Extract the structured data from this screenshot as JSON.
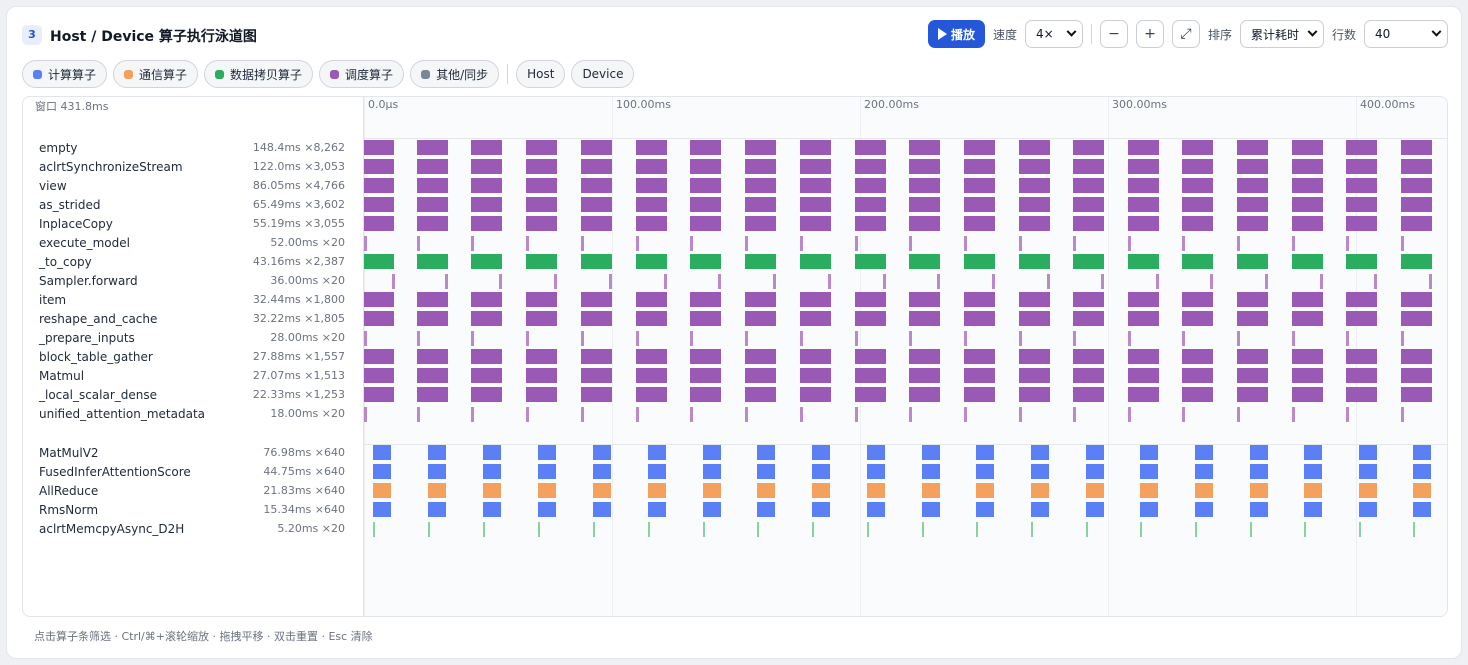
{
  "header": {
    "step": "3",
    "title": "Host / Device 算子执行泳道图",
    "play_label": "播放",
    "speed_label": "速度",
    "speed_value": "4×",
    "zoom_out": "−",
    "zoom_in": "+",
    "fit": "⤢",
    "sort_label": "排序",
    "sort_value": "累计耗时",
    "rows_label": "行数",
    "rows_value": "40"
  },
  "colors": {
    "compute": "#5b7ff5",
    "comm": "#f4a15d",
    "copy": "#2aad5e",
    "sched": "#9b59b6",
    "other": "#7b8794"
  },
  "filters": {
    "compute": "计算算子",
    "comm": "通信算子",
    "copy": "数据拷贝算子",
    "sched": "调度算子",
    "other": "其他/同步",
    "host": "Host",
    "device": "Device"
  },
  "axis": {
    "window_label": "窗口 431.8ms",
    "ticks": [
      "0.0μs",
      "100.00ms",
      "200.00ms",
      "300.00ms",
      "400.00ms"
    ]
  },
  "host_rows": [
    {
      "name": "empty",
      "stat": "148.4ms ×8,262",
      "kind": "sched"
    },
    {
      "name": "aclrtSynchronizeStream",
      "stat": "122.0ms ×3,053",
      "kind": "sched"
    },
    {
      "name": "view",
      "stat": "86.05ms ×4,766",
      "kind": "sched"
    },
    {
      "name": "as_strided",
      "stat": "65.49ms ×3,602",
      "kind": "sched"
    },
    {
      "name": "InplaceCopy",
      "stat": "55.19ms ×3,055",
      "kind": "sched"
    },
    {
      "name": "execute_model",
      "stat": "52.00ms ×20",
      "kind": "sched"
    },
    {
      "name": "_to_copy",
      "stat": "43.16ms ×2,387",
      "kind": "copy"
    },
    {
      "name": "Sampler.forward",
      "stat": "36.00ms ×20",
      "kind": "sched"
    },
    {
      "name": "item",
      "stat": "32.44ms ×1,800",
      "kind": "sched"
    },
    {
      "name": "reshape_and_cache",
      "stat": "32.22ms ×1,805",
      "kind": "sched"
    },
    {
      "name": "_prepare_inputs",
      "stat": "28.00ms ×20",
      "kind": "sched"
    },
    {
      "name": "block_table_gather",
      "stat": "27.88ms ×1,557",
      "kind": "sched"
    },
    {
      "name": "Matmul",
      "stat": "27.07ms ×1,513",
      "kind": "sched"
    },
    {
      "name": "_local_scalar_dense",
      "stat": "22.33ms ×1,253",
      "kind": "sched"
    },
    {
      "name": "unified_attention_metadata",
      "stat": "18.00ms ×20",
      "kind": "sched"
    }
  ],
  "device_rows": [
    {
      "name": "MatMulV2",
      "stat": "76.98ms ×640",
      "kind": "compute"
    },
    {
      "name": "FusedInferAttentionScore",
      "stat": "44.75ms ×640",
      "kind": "compute"
    },
    {
      "name": "AllReduce",
      "stat": "21.83ms ×640",
      "kind": "comm"
    },
    {
      "name": "RmsNorm",
      "stat": "15.34ms ×640",
      "kind": "compute"
    },
    {
      "name": "aclrtMemcpyAsync_D2H",
      "stat": "5.20ms ×20",
      "kind": "copy"
    }
  ],
  "footer": "点击算子条筛选 · Ctrl/⌘+滚轮缩放 · 拖拽平移 · 双击重置 · Esc 清除"
}
